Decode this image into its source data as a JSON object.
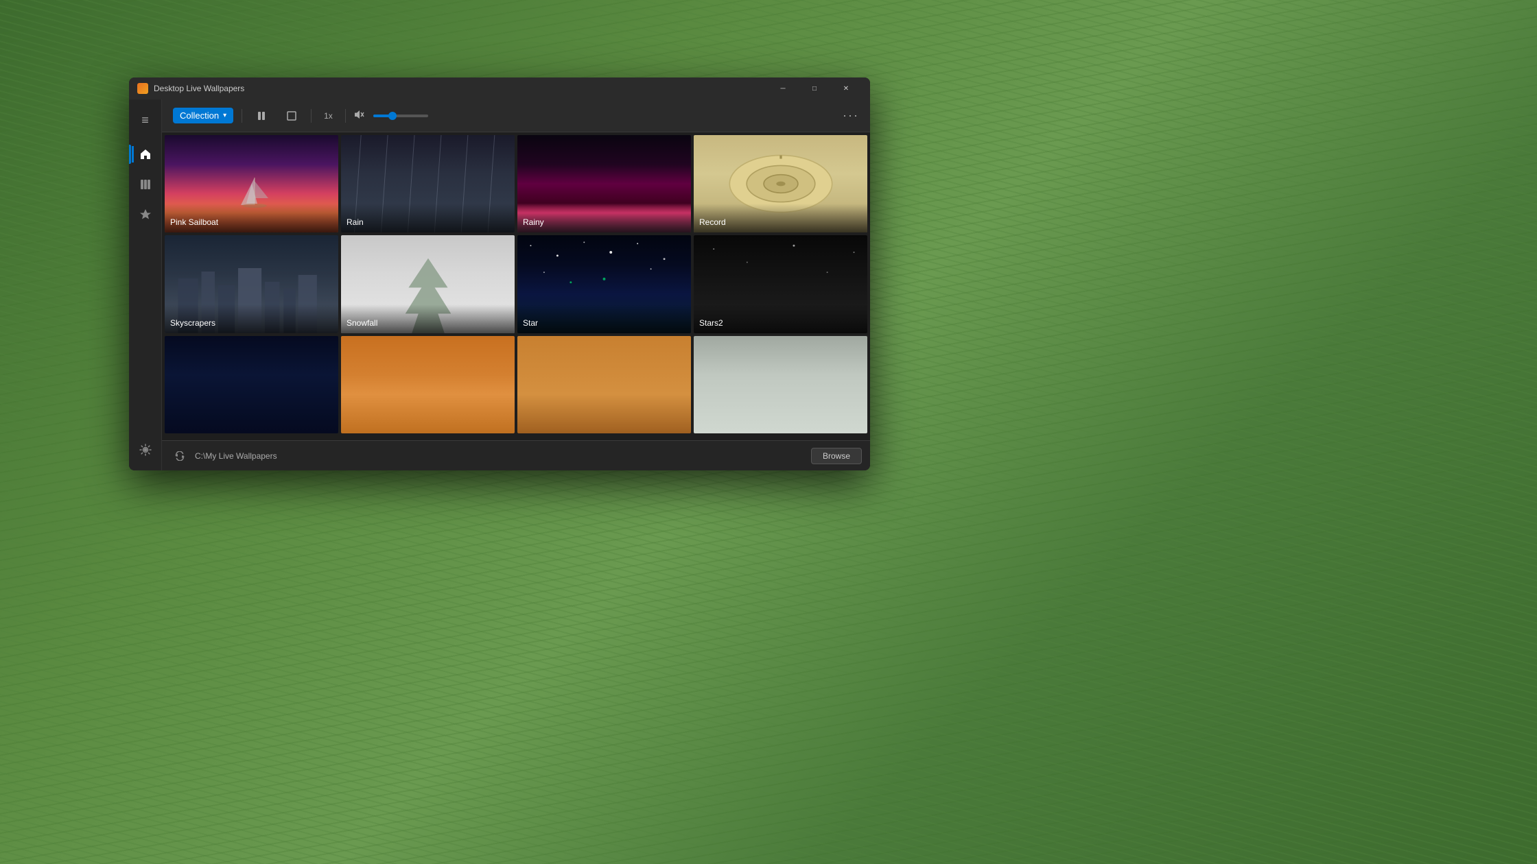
{
  "background": {
    "color": "#4a7a3a"
  },
  "window": {
    "title": "Desktop Live Wallpapers",
    "icon": "app-icon",
    "controls": {
      "minimize": "─",
      "restore": "□",
      "close": "✕"
    }
  },
  "toolbar": {
    "collection_label": "Collection",
    "collection_chevron": "▾",
    "pause_icon": "pause",
    "square_icon": "square",
    "speed_label": "1x",
    "mute_icon": "mute",
    "volume_percent": 35,
    "more_icon": "more"
  },
  "sidebar": {
    "menu_icon": "≡",
    "items": [
      {
        "icon": "home",
        "label": "Home",
        "active": true
      },
      {
        "icon": "library",
        "label": "Library",
        "active": false
      },
      {
        "icon": "favorites",
        "label": "Favorites",
        "active": false
      }
    ],
    "settings_icon": "settings"
  },
  "grid": {
    "items": [
      {
        "id": "pink-sailboat",
        "label": "Pink Sailboat",
        "theme": "pink-sailboat"
      },
      {
        "id": "rain",
        "label": "Rain",
        "theme": "rain"
      },
      {
        "id": "rainy",
        "label": "Rainy",
        "theme": "rainy"
      },
      {
        "id": "record",
        "label": "Record",
        "theme": "record"
      },
      {
        "id": "skyscrapers",
        "label": "Skyscrapers",
        "theme": "skyscrapers"
      },
      {
        "id": "snowfall",
        "label": "Snowfall",
        "theme": "snowfall"
      },
      {
        "id": "star",
        "label": "Star",
        "theme": "star"
      },
      {
        "id": "stars2",
        "label": "Stars2",
        "theme": "stars2"
      },
      {
        "id": "row3-1",
        "label": "",
        "theme": "row3-1"
      },
      {
        "id": "row3-2",
        "label": "",
        "theme": "row3-2"
      },
      {
        "id": "row3-3",
        "label": "",
        "theme": "row3-3"
      },
      {
        "id": "row3-4",
        "label": "",
        "theme": "row3-4"
      }
    ]
  },
  "bottom_bar": {
    "path": "C:\\My Live Wallpapers",
    "browse_label": "Browse",
    "refresh_icon": "refresh"
  }
}
